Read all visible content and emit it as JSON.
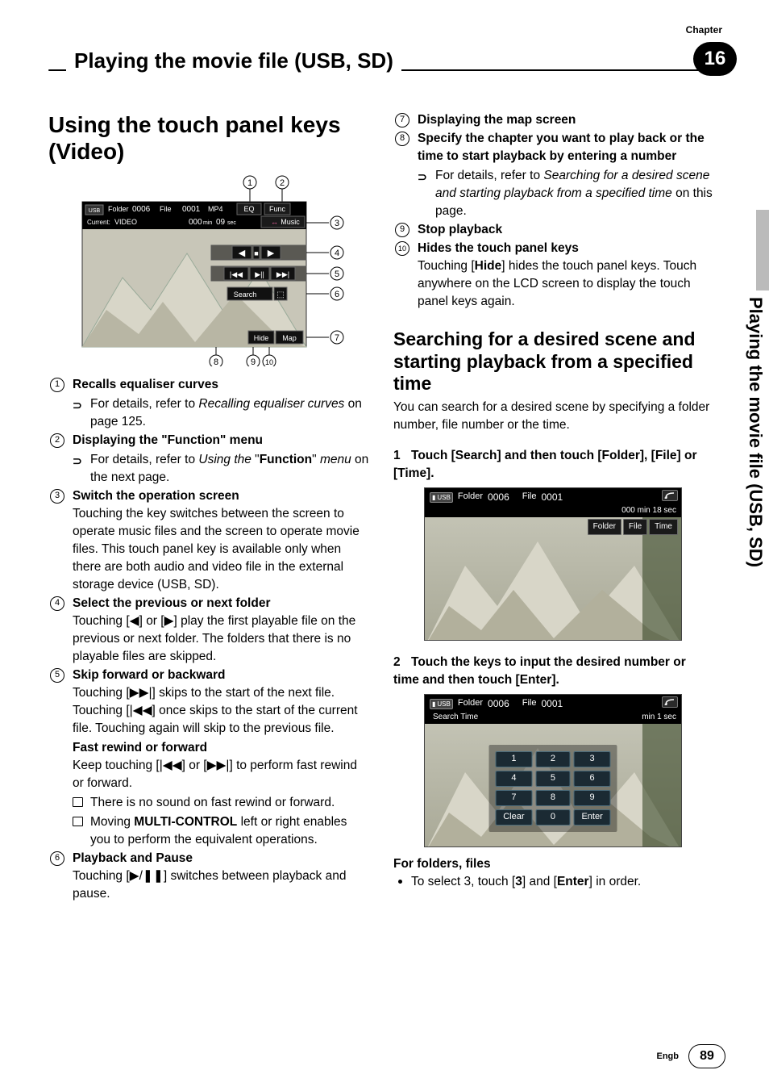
{
  "chapter": {
    "label": "Chapter",
    "number": "16"
  },
  "section_title": "Playing the movie file (USB, SD)",
  "side_tab": "Playing the movie file (USB, SD)",
  "left": {
    "heading": "Using the touch panel keys (Video)",
    "fig1": {
      "callouts": [
        "1",
        "2",
        "3",
        "4",
        "5",
        "6",
        "7",
        "8",
        "9",
        "10"
      ],
      "topbar": {
        "media_icon": "USB",
        "folder_label": "Folder",
        "folder_value": "0006",
        "file_label": "File",
        "file_value": "0001",
        "format": "MP4",
        "current_label": "Current:",
        "current_value": "VIDEO",
        "time_min": "000",
        "time_min_unit": "min",
        "time_sec": "09",
        "time_sec_unit": "sec",
        "eq_btn": "EQ",
        "func_btn": "Func",
        "music_btn": "Music"
      },
      "controls": {
        "search_btn": "Search",
        "hide_btn": "Hide",
        "map_btn": "Map"
      }
    },
    "items": [
      {
        "num": "1",
        "title": "Recalls equaliser curves",
        "sub": [
          {
            "type": "arrow",
            "html": [
              "For details, refer to ",
              {
                "i": "Recalling equaliser curves"
              },
              " on page 125."
            ]
          }
        ]
      },
      {
        "num": "2",
        "title": "Displaying the \"Function\" menu",
        "sub": [
          {
            "type": "arrow",
            "html": [
              "For details, refer to ",
              {
                "i": "Using the"
              },
              " \"",
              {
                "b": "Function"
              },
              "\" ",
              {
                "i": "menu"
              },
              " on the next page."
            ]
          }
        ]
      },
      {
        "num": "3",
        "title": "Switch the operation screen",
        "body": "Touching the key switches between the screen to operate music files and the screen to operate movie files. This touch panel key is available only when there are both audio and video file in the external storage device (USB, SD)."
      },
      {
        "num": "4",
        "title": "Select the previous or next folder",
        "body_html": [
          "Touching [",
          {
            "sym": "◀"
          },
          "] or [",
          {
            "sym": "▶"
          },
          "] play the first playable file on the previous or next folder. The folders that there is no playable files are skipped."
        ]
      },
      {
        "num": "5",
        "title": "Skip forward or backward",
        "body_html": [
          "Touching [",
          {
            "sym": "▶▶|"
          },
          "] skips to the start of the next file. Touching [",
          {
            "sym": "|◀◀"
          },
          "] once skips to the start of the current file. Touching again will skip to the previous file."
        ],
        "subtitle": "Fast rewind or forward",
        "sub_body_html": [
          "Keep touching [",
          {
            "sym": "|◀◀"
          },
          "] or [",
          {
            "sym": "▶▶|"
          },
          "] to perform fast rewind or forward."
        ],
        "notes": [
          {
            "type": "sq",
            "text": "There is no sound on fast rewind or forward."
          },
          {
            "type": "sq",
            "html": [
              "Moving ",
              {
                "b": "MULTI-CONTROL"
              },
              " left or right enables you to perform the equivalent operations."
            ]
          }
        ]
      },
      {
        "num": "6",
        "title": "Playback and Pause",
        "body_html": [
          "Touching [",
          {
            "sym": "▶"
          },
          "/",
          {
            "sym": "❚❚"
          },
          "] switches between playback and pause."
        ]
      }
    ]
  },
  "right": {
    "items_cont": [
      {
        "num": "7",
        "title": "Displaying the map screen"
      },
      {
        "num": "8",
        "title": "Specify the chapter you want to play back or the time to start playback by entering a number",
        "sub": [
          {
            "type": "arrow",
            "html": [
              "For details, refer to ",
              {
                "i": "Searching for a desired scene and starting playback from a specified time"
              },
              " on this page."
            ]
          }
        ]
      },
      {
        "num": "9",
        "title": "Stop playback"
      },
      {
        "num": "a",
        "display_num": "10",
        "title": "Hides the touch panel keys",
        "body_html": [
          "Touching [",
          {
            "b": "Hide"
          },
          "] hides the touch panel keys. Touch anywhere on the LCD screen to display the touch panel keys again."
        ]
      }
    ],
    "subheading": "Searching for a desired scene and starting playback from a specified time",
    "intro": "You can search for a desired scene by specifying a folder number, file number or the time.",
    "step1": {
      "num": "1",
      "text": "Touch [Search] and then touch [Folder], [File] or [Time]."
    },
    "shot1": {
      "media_icon": "USB",
      "folder_label": "Folder",
      "folder_value": "0006",
      "file_label": "File",
      "file_value": "0001",
      "time": "000 min 18 sec",
      "tabs": [
        "Folder",
        "File",
        "Time"
      ]
    },
    "step2": {
      "num": "2",
      "text": "Touch the keys to input the desired number or time and then touch [Enter]."
    },
    "shot2": {
      "media_icon": "USB",
      "folder_label": "Folder",
      "folder_value": "0006",
      "file_label": "File",
      "file_value": "0001",
      "mode": "Search Time",
      "time_right": "min   1 sec",
      "keys": [
        [
          "1",
          "2",
          "3"
        ],
        [
          "4",
          "5",
          "6"
        ],
        [
          "7",
          "8",
          "9"
        ],
        [
          "Clear",
          "0",
          "Enter"
        ]
      ]
    },
    "for_folders_title": "For folders, files",
    "for_folders_bullet_html": [
      "To select 3, touch [",
      {
        "b": "3"
      },
      "] and [",
      {
        "b": "Enter"
      },
      "] in order."
    ]
  },
  "footer": {
    "lang": "Engb",
    "page": "89"
  }
}
